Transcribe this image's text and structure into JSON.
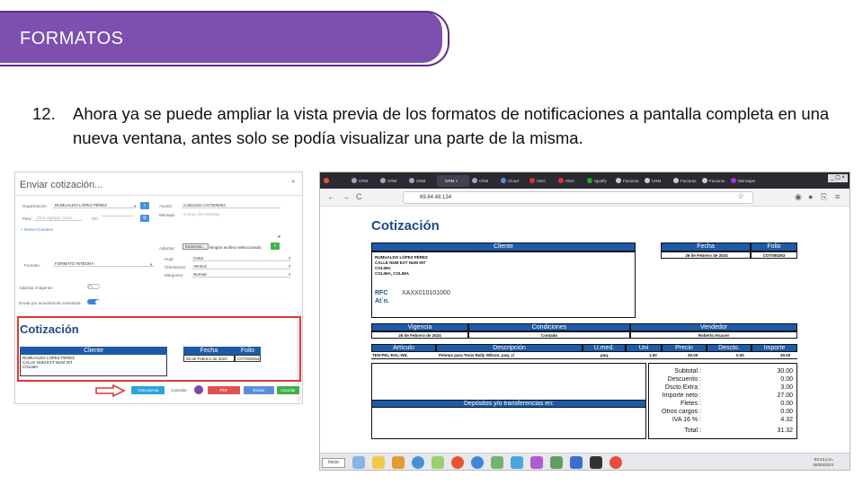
{
  "header": {
    "title": "FORMATOS"
  },
  "body": {
    "item_number": "12.",
    "text": "Ahora ya se puede ampliar la vista previa de los formatos de notificaciones a pantalla completa en una nueva ventana, antes solo se podía visualizar una parte de la misma."
  },
  "dialog": {
    "title": "Enviar cotización...",
    "close": "×",
    "org_label": "Organización:",
    "org_value": "RUMUALDO LÓPEZ PÉREZ",
    "para_label": "Para:",
    "para_placeholder": "Click agregar conta...",
    "cc_label": "CC:",
    "new_contact": "+ Nuevo Contacto",
    "asunto_label": "Asunto:",
    "asunto_value": "Cotización COT000263",
    "mensaje_label": "Mensaje:",
    "mensaje_placeholder": "Cuerpo del mensaje",
    "adjuntar_label": "Adjuntar:",
    "browse": "Examinar...",
    "no_file": "Ningún archivo seleccionado.",
    "formato_label": "Formato:",
    "formato_value": "FORMATO INTEGRA",
    "hoja_label": "Hoja:",
    "hoja_value": "Carta",
    "orient_label": "Orientación:",
    "orient_value": "Vertical",
    "margin_label": "Márgenes:",
    "margin_value": "Normal",
    "images_label": "Adjuntar imágenes",
    "thumbs_label": "Enviar por actualización inmediata",
    "preview": {
      "title": "Cotización",
      "cliente_h": "Cliente",
      "fecha_h": "Fecha",
      "folio_h": "Folio",
      "lines": [
        "RUMUALDO LÓPEZ PÉREZ",
        "CALLE NUM EXT NUM INT",
        "COLIMA"
      ],
      "fecha": "26 de Febrero de 2024",
      "folio": "COT000263"
    },
    "btn_preview": "Vista previa",
    "btn_cancel": "Cancelar",
    "btn_pdf": "PDF",
    "btn_send": "Enviar",
    "btn_save": "Guardar"
  },
  "browser": {
    "url": "69.64.48.134",
    "tabs": [
      "CRM",
      "CRM",
      "CRM",
      "CRM",
      "CRM",
      "Cloud",
      "CEO",
      "CEO",
      "Spotify",
      "Facturas",
      "CRM",
      "Facturas",
      "Facturas",
      "Mensajes"
    ],
    "win_controls": "_ ▢ ×"
  },
  "document": {
    "title": "Cotización",
    "cliente_h": "Cliente",
    "cliente_lines": [
      "RUMUALDO LÓPEZ PÉREZ",
      "CALLE NUM EXT NUM INT",
      "COLIMA",
      "COLIMA, COLIMA"
    ],
    "rfc_label": "RFC",
    "rfc_value": "XAXX010101000",
    "atn_label": "At`n.",
    "fecha_h": "Fecha",
    "folio_h": "Folio",
    "fecha": "26 de Febrero de 2024",
    "folio": "COT000263",
    "vigencia_h": "Vigencia",
    "condiciones_h": "Condiciones",
    "vendedor_h": "Vendedor",
    "vigencia": "26 de Febrero de 2024",
    "condiciones": "Contado",
    "vendedor": "Roberto Alcacer",
    "items_h": [
      "Artículo",
      "Descripción",
      "U.med.",
      "Uni",
      "Precio",
      "Descto.",
      "Importe"
    ],
    "items": [
      [
        "TEN-PEL-RAL-WIL",
        "Pelotas para Tenis Rally Wilson, paq. c/",
        "paq.",
        "1.00",
        "30.00",
        "0.00",
        "30.00"
      ]
    ],
    "depositos_h": "Depósitos y/o transferencias en:",
    "totals": [
      [
        "Subtotal :",
        "30.00"
      ],
      [
        "Descuento :",
        "0.00"
      ],
      [
        "Dscto Extra :",
        "3.00"
      ],
      [
        "Importe neto :",
        "27.00"
      ],
      [
        "Fletes :",
        "0.00"
      ],
      [
        "Otros cargos :",
        "0.00"
      ],
      [
        "IVA 16 % :",
        "4.32"
      ],
      [
        "Total :",
        "31.32"
      ]
    ]
  },
  "taskbar": {
    "start": "Inicio",
    "time": "03:13 p.m.",
    "date": "06/03/2024"
  }
}
